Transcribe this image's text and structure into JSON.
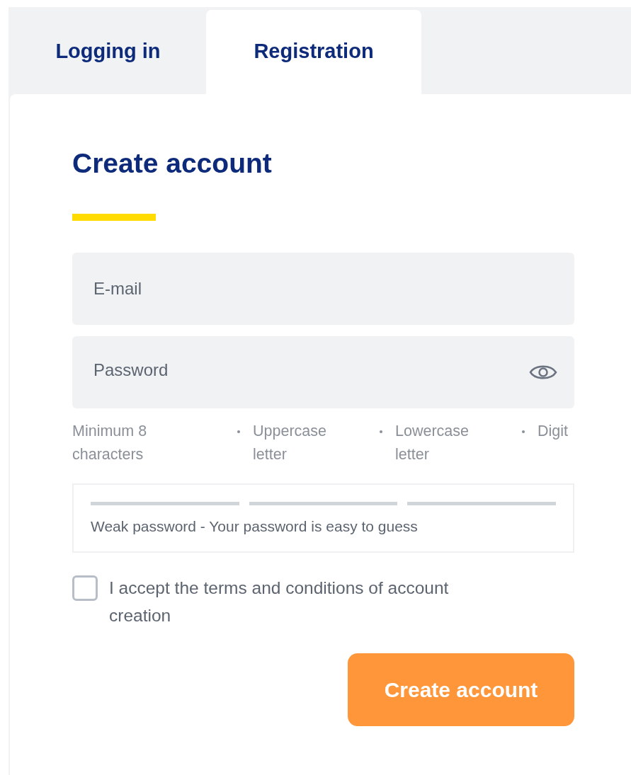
{
  "tabs": [
    {
      "label": "Logging in",
      "selected": false
    },
    {
      "label": "Registration",
      "selected": true
    }
  ],
  "form": {
    "title": "Create account",
    "email": {
      "placeholder": "E-mail"
    },
    "password": {
      "placeholder": "Password"
    },
    "requirements": [
      "Minimum 8 characters",
      "Uppercase letter",
      "Lowercase letter",
      "Digit"
    ],
    "strength": {
      "message": "Weak password - Your password is easy to guess"
    },
    "terms": {
      "label": "I accept the terms and conditions of account creation",
      "checked": false
    },
    "submit": "Create account"
  }
}
